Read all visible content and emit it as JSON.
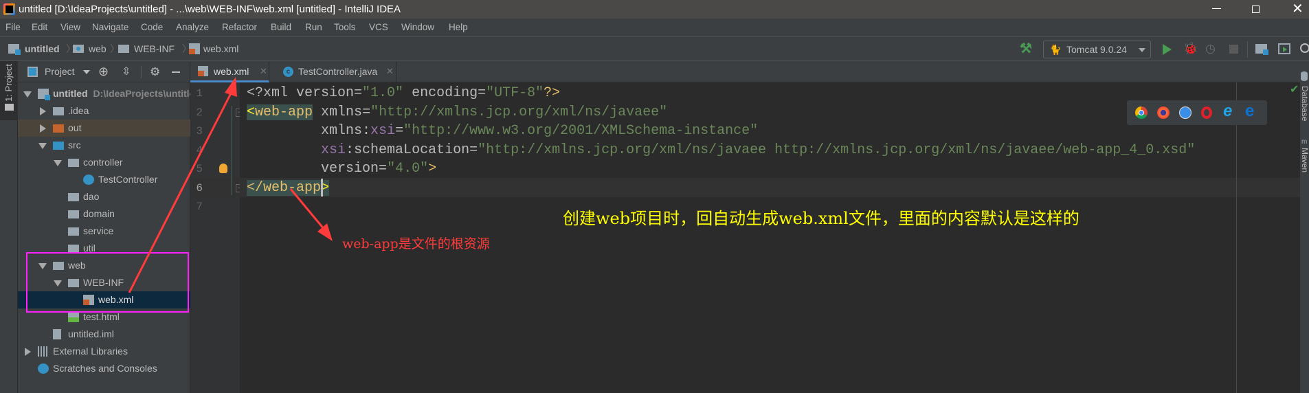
{
  "window": {
    "title": "untitled [D:\\IdeaProjects\\untitled] - ...\\web\\WEB-INF\\web.xml [untitled] - IntelliJ IDEA"
  },
  "menu": [
    "File",
    "Edit",
    "View",
    "Navigate",
    "Code",
    "Analyze",
    "Refactor",
    "Build",
    "Run",
    "Tools",
    "VCS",
    "Window",
    "Help"
  ],
  "breadcrumb": [
    "untitled",
    "web",
    "WEB-INF",
    "web.xml"
  ],
  "toolbar": {
    "run_config": "Tomcat 9.0.24"
  },
  "left_stripe": {
    "project_label": "1: Project"
  },
  "right_stripe": {
    "database_label": "Database",
    "maven_label": "Maven"
  },
  "project_panel": {
    "title": "Project",
    "tree": [
      {
        "label": "untitled",
        "path": "D:\\IdeaProjects\\untitled",
        "level": 0,
        "toggle": "open",
        "icon": "module",
        "bold": true
      },
      {
        "label": ".idea",
        "level": 1,
        "toggle": "closed",
        "icon": "folder"
      },
      {
        "label": "out",
        "level": 1,
        "toggle": "closed",
        "icon": "folder-excluded",
        "highlight": "excluded"
      },
      {
        "label": "src",
        "level": 1,
        "toggle": "open",
        "icon": "folder-source"
      },
      {
        "label": "controller",
        "level": 2,
        "toggle": "open",
        "icon": "package"
      },
      {
        "label": "TestController",
        "level": 3,
        "icon": "class"
      },
      {
        "label": "dao",
        "level": 2,
        "icon": "package"
      },
      {
        "label": "domain",
        "level": 2,
        "icon": "package"
      },
      {
        "label": "service",
        "level": 2,
        "icon": "package"
      },
      {
        "label": "util",
        "level": 2,
        "icon": "package"
      },
      {
        "label": "web",
        "level": 1,
        "toggle": "open",
        "icon": "folder-web"
      },
      {
        "label": "WEB-INF",
        "level": 2,
        "toggle": "open",
        "icon": "folder"
      },
      {
        "label": "web.xml",
        "level": 3,
        "icon": "xml",
        "selected": true
      },
      {
        "label": "test.html",
        "level": 2,
        "icon": "html"
      },
      {
        "label": "untitled.iml",
        "level": 1,
        "icon": "iml"
      },
      {
        "label": "External Libraries",
        "level": 0,
        "toggle": "closed",
        "icon": "libraries"
      },
      {
        "label": "Scratches and Consoles",
        "level": 0,
        "icon": "scratches"
      }
    ]
  },
  "tabs": [
    {
      "label": "web.xml",
      "icon": "xml",
      "active": true
    },
    {
      "label": "TestController.java",
      "icon": "class",
      "active": false
    }
  ],
  "editor": {
    "lines": [
      [
        [
          "pi",
          "<?xml "
        ],
        [
          "attr",
          "version"
        ],
        [
          "plain",
          "="
        ],
        [
          "val",
          "\"1.0\""
        ],
        [
          "plain",
          " "
        ],
        [
          "attr",
          "encoding"
        ],
        [
          "plain",
          "="
        ],
        [
          "val",
          "\"UTF-8\""
        ],
        [
          "tag",
          "?>"
        ]
      ],
      [
        [
          "brace",
          "<"
        ],
        [
          "tagm",
          "web-app"
        ],
        [
          "plain",
          " "
        ],
        [
          "attr",
          "xmlns"
        ],
        [
          "plain",
          "="
        ],
        [
          "val",
          "\"http://xmlns.jcp.org/xml/ns/javaee\""
        ]
      ],
      [
        [
          "plain",
          "         "
        ],
        [
          "attr",
          "xmlns:"
        ],
        [
          "ns",
          "xsi"
        ],
        [
          "plain",
          "="
        ],
        [
          "val",
          "\"http://www.w3.org/2001/XMLSchema-instance\""
        ]
      ],
      [
        [
          "plain",
          "         "
        ],
        [
          "ns",
          "xsi"
        ],
        [
          "attr",
          ":schemaLocation"
        ],
        [
          "plain",
          "="
        ],
        [
          "val",
          "\"http://xmlns.jcp.org/xml/ns/javaee http://xmlns.jcp.org/xml/ns/javaee/web-app_4_0.xsd\""
        ]
      ],
      [
        [
          "plain",
          "         "
        ],
        [
          "attr",
          "version"
        ],
        [
          "plain",
          "="
        ],
        [
          "val",
          "\"4.0\""
        ],
        [
          "tag",
          ">"
        ]
      ],
      [
        [
          "tagm",
          "</web-app"
        ],
        [
          "brace",
          ">"
        ]
      ],
      []
    ],
    "line_numbers": [
      "1",
      "2",
      "3",
      "4",
      "5",
      "6",
      "7"
    ]
  },
  "annotations": {
    "note_main": "创建web项目时，回自动生成web.xml文件，里面的内容默认是这样的",
    "note_root": "web-app是文件的根资源"
  },
  "colors": {
    "tag": "#e8bf6a",
    "attr": "#bababa",
    "value": "#6a8759",
    "namespace": "#9876aa",
    "brace_match": "#ffef28",
    "note_main": "#ffff00",
    "note_root": "#ff3b3b",
    "highlight_box": "#ff22ff",
    "arrow": "#ff3b3b",
    "selection": "#0d293e"
  }
}
